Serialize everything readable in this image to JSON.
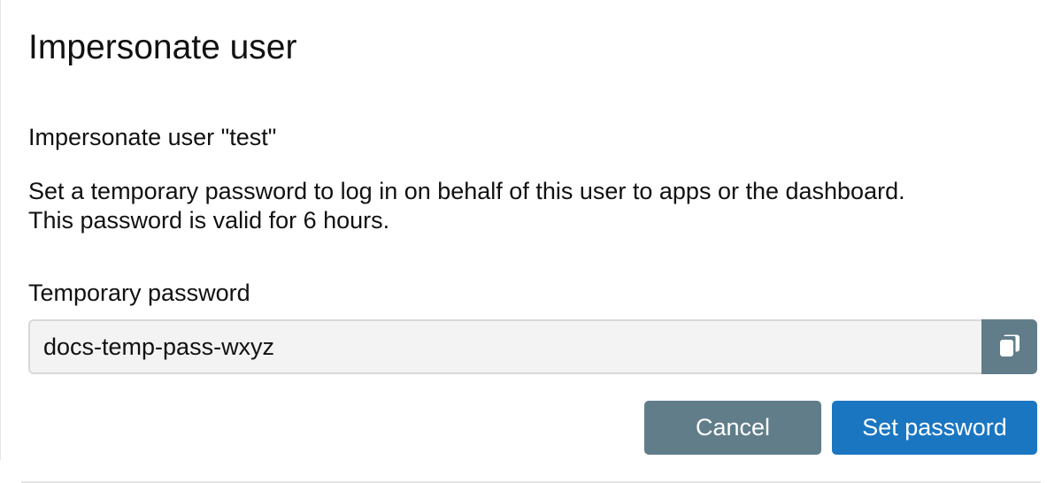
{
  "dialog": {
    "title": "Impersonate user",
    "subject": "Impersonate user \"test\"",
    "description_line1": "Set a temporary password to log in on behalf of this user to apps or the dashboard.",
    "description_line2": "This password is valid for 6 hours."
  },
  "password_field": {
    "label": "Temporary password",
    "value": "docs-temp-pass-wxyz",
    "copy_icon": "copy-icon"
  },
  "actions": {
    "cancel_label": "Cancel",
    "submit_label": "Set password"
  },
  "colors": {
    "primary": "#1b76c1",
    "secondary": "#617d8a",
    "input_bg": "#f3f3f3"
  }
}
